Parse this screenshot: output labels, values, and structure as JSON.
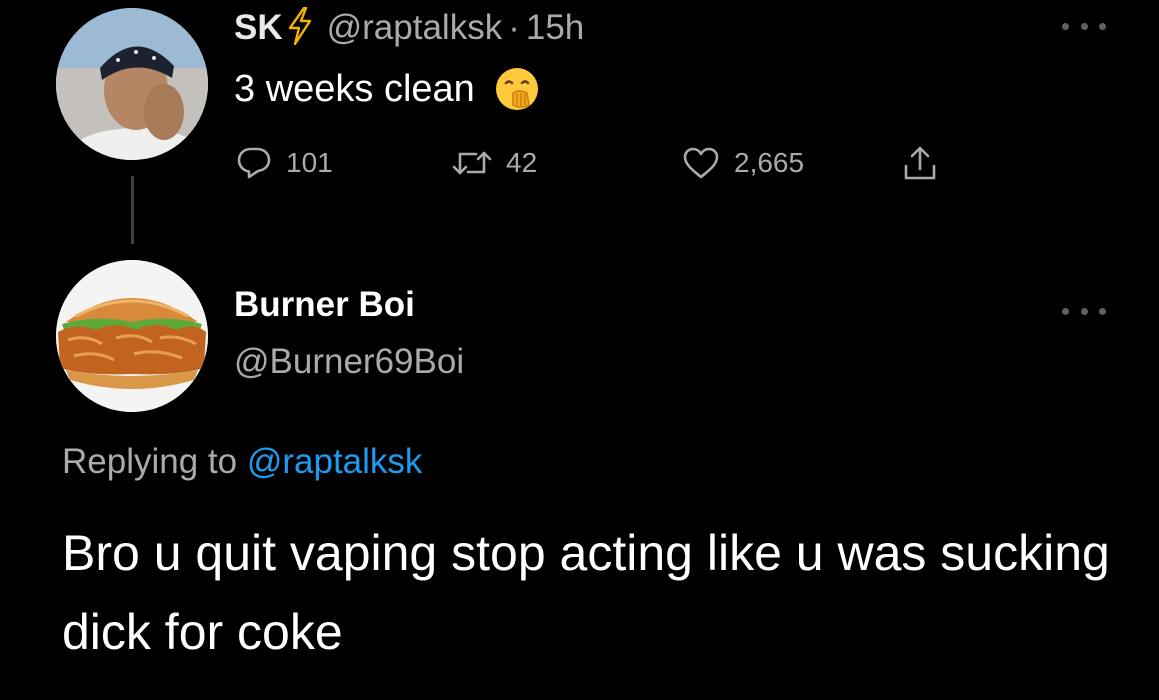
{
  "original_tweet": {
    "display_name": "SK",
    "verified_icon": "lightning-bolt-icon",
    "handle": "@raptalksk",
    "separator": "·",
    "time": "15h",
    "text": "3 weeks clean",
    "emoji": "face-with-hand-over-mouth-emoji",
    "actions": {
      "replies": "101",
      "retweets": "42",
      "likes": "2,665"
    }
  },
  "reply_tweet": {
    "display_name": "Burner Boi",
    "handle": "@Burner69Boi",
    "replying_prefix": "Replying to",
    "replying_to": "@raptalksk",
    "text": "Bro u quit vaping stop acting like u was sucking dick for coke"
  },
  "colors": {
    "background": "#000000",
    "primary_text": "#e7e9ea",
    "secondary_text": "#a7abae",
    "link": "#1d9bf0",
    "bolt": "#f5b100"
  }
}
